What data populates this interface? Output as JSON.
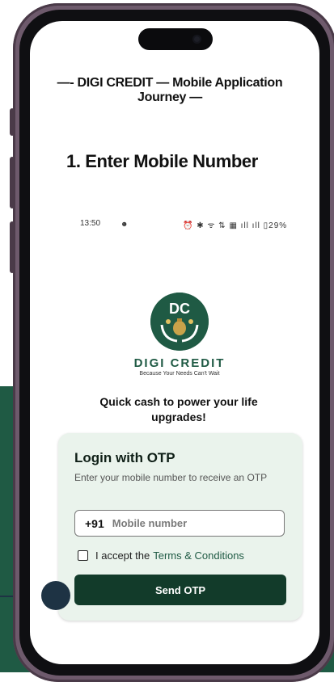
{
  "page": {
    "journey_title": "—- DIGI CREDIT — Mobile Application Journey —",
    "step_title": "1.  Enter Mobile Number"
  },
  "status_bar": {
    "time": "13:50",
    "notification_icon": "☻",
    "icons_text": "⏰ ✱ ᯤ ⇅ ▦ ıll ıll ▯29%"
  },
  "brand": {
    "logo_text": "DC",
    "name": "DIGI CREDIT",
    "tagline": "Because Your Needs Can't Wait"
  },
  "hero": {
    "line1": "Quick cash to power your life",
    "line2": "upgrades!"
  },
  "login": {
    "title": "Login with OTP",
    "subtitle": "Enter your mobile number to receive an OTP",
    "country_code": "+91",
    "mobile_placeholder": "Mobile number",
    "terms_prefix": "I accept the",
    "terms_link": "Terms & Conditions",
    "send_button": "Send OTP"
  },
  "colors": {
    "brand_green": "#1f5a44",
    "button_dark": "#123b2a",
    "card_bg": "#eaf3ec",
    "phone_frame": "#6e5a6c",
    "annotation": "#1e3344"
  }
}
